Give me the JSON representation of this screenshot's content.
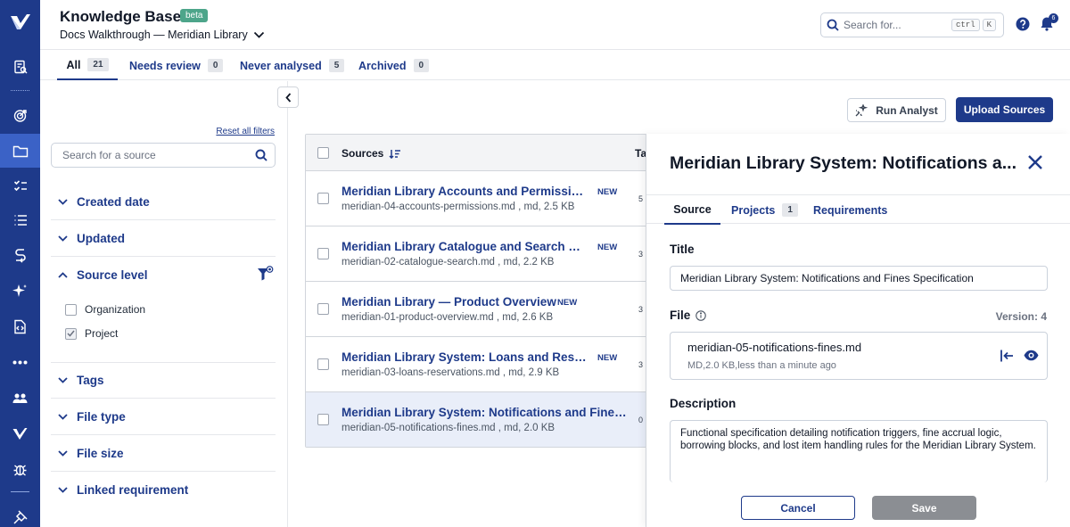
{
  "header": {
    "title": "Knowledge Base",
    "badge": "beta",
    "doc_selector": "Docs Walkthrough — Meridian Library",
    "search_placeholder": "Search for...",
    "shortcut_ctrl": "ctrl",
    "shortcut_key": "K",
    "notification_count": "6"
  },
  "tabs": [
    {
      "label": "All",
      "count": "21"
    },
    {
      "label": "Needs review",
      "count": "0"
    },
    {
      "label": "Never analysed",
      "count": "5"
    },
    {
      "label": "Archived",
      "count": "0"
    }
  ],
  "filters": {
    "reset_label": "Reset all filters",
    "search_placeholder": "Search for a source",
    "sections": {
      "created_date": "Created date",
      "updated": "Updated",
      "source_level": "Source level",
      "tags": "Tags",
      "file_type": "File type",
      "file_size": "File size",
      "linked_requirement": "Linked requirement"
    },
    "source_level_options": [
      {
        "label": "Organization",
        "checked": false
      },
      {
        "label": "Project",
        "checked": true
      }
    ]
  },
  "actions": {
    "run_analyst": "Run Analyst",
    "upload_sources": "Upload Sources"
  },
  "table": {
    "columns": {
      "sources": "Sources",
      "tags": "Ta"
    },
    "rows": [
      {
        "name": "Meridian Library Accounts and Permission...",
        "badge": "NEW",
        "file": "meridian-04-accounts-permissions.md",
        "type": "md",
        "size": "2.5 KB",
        "tags": "5"
      },
      {
        "name": "Meridian Library Catalogue and Search Fu...",
        "badge": "NEW",
        "file": "meridian-02-catalogue-search.md",
        "type": "md",
        "size": "2.2 KB",
        "tags": "3"
      },
      {
        "name": "Meridian Library — Product Overview",
        "badge": "NEW",
        "file": "meridian-01-product-overview.md",
        "type": "md",
        "size": "2.6 KB",
        "tags": "3"
      },
      {
        "name": "Meridian Library System: Loans and Reser...",
        "badge": "NEW",
        "file": "meridian-03-loans-reservations.md",
        "type": "md",
        "size": "2.9 KB",
        "tags": "3"
      },
      {
        "name": "Meridian Library System: Notifications and Fines ...",
        "badge": "",
        "file": "meridian-05-notifications-fines.md",
        "type": "md",
        "size": "2.0 KB",
        "tags": "0"
      }
    ]
  },
  "panel": {
    "title": "Meridian Library System: Notifications a...",
    "tabs": {
      "source": "Source",
      "projects": "Projects",
      "projects_count": "1",
      "requirements": "Requirements"
    },
    "title_label": "Title",
    "title_value": "Meridian Library System: Notifications and Fines Specification",
    "file_label": "File",
    "version": "Version: 4",
    "file_name": "meridian-05-notifications-fines.md",
    "file_meta": "MD,2.0 KB,less than a minute ago",
    "description_label": "Description",
    "description": "Functional specification detailing notification triggers, fine accrual logic, borrowing blocks, and lost item handling rules for the Meridian Library System.",
    "cancel": "Cancel",
    "save": "Save"
  },
  "colors": {
    "brand": "#1e3a8a",
    "rail_active": "#3b62c6",
    "beta_badge": "#4da58a",
    "save_disabled": "#8b8e93"
  }
}
